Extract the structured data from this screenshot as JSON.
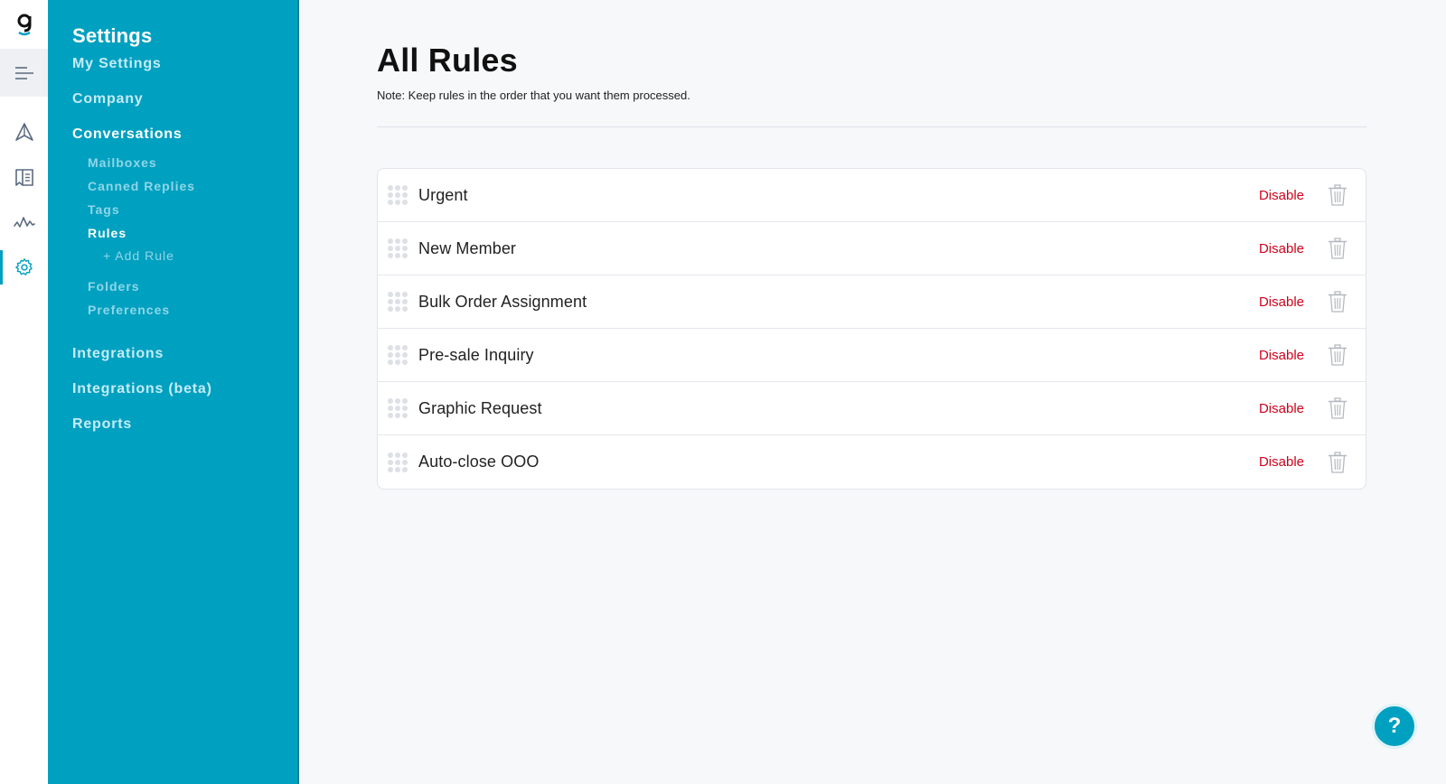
{
  "rail": {
    "logo": "g",
    "icons": [
      "menu-icon",
      "send-icon",
      "book-icon",
      "activity-icon",
      "gear-icon"
    ]
  },
  "sidebar": {
    "title": "Settings",
    "items": [
      {
        "label": "My Settings"
      },
      {
        "label": "Company"
      },
      {
        "label": "Conversations"
      }
    ],
    "sub_items": [
      {
        "label": "Mailboxes"
      },
      {
        "label": "Canned Replies"
      },
      {
        "label": "Tags"
      },
      {
        "label": "Rules"
      },
      {
        "label": "+ Add Rule"
      },
      {
        "label": "Folders"
      },
      {
        "label": "Preferences"
      }
    ],
    "bottom_items": [
      {
        "label": "Integrations"
      },
      {
        "label": "Integrations (beta)"
      },
      {
        "label": "Reports"
      }
    ]
  },
  "main": {
    "title": "All Rules",
    "note": "Note: Keep rules in the order that you want them processed.",
    "rules": [
      {
        "name": "Urgent",
        "action": "Disable"
      },
      {
        "name": "New Member",
        "action": "Disable"
      },
      {
        "name": "Bulk Order Assignment",
        "action": "Disable"
      },
      {
        "name": "Pre-sale Inquiry",
        "action": "Disable"
      },
      {
        "name": "Graphic Request",
        "action": "Disable"
      },
      {
        "name": "Auto-close OOO",
        "action": "Disable"
      }
    ]
  },
  "help": {
    "label": "?"
  },
  "colors": {
    "accent": "#00a0c0",
    "danger": "#d0021b"
  }
}
